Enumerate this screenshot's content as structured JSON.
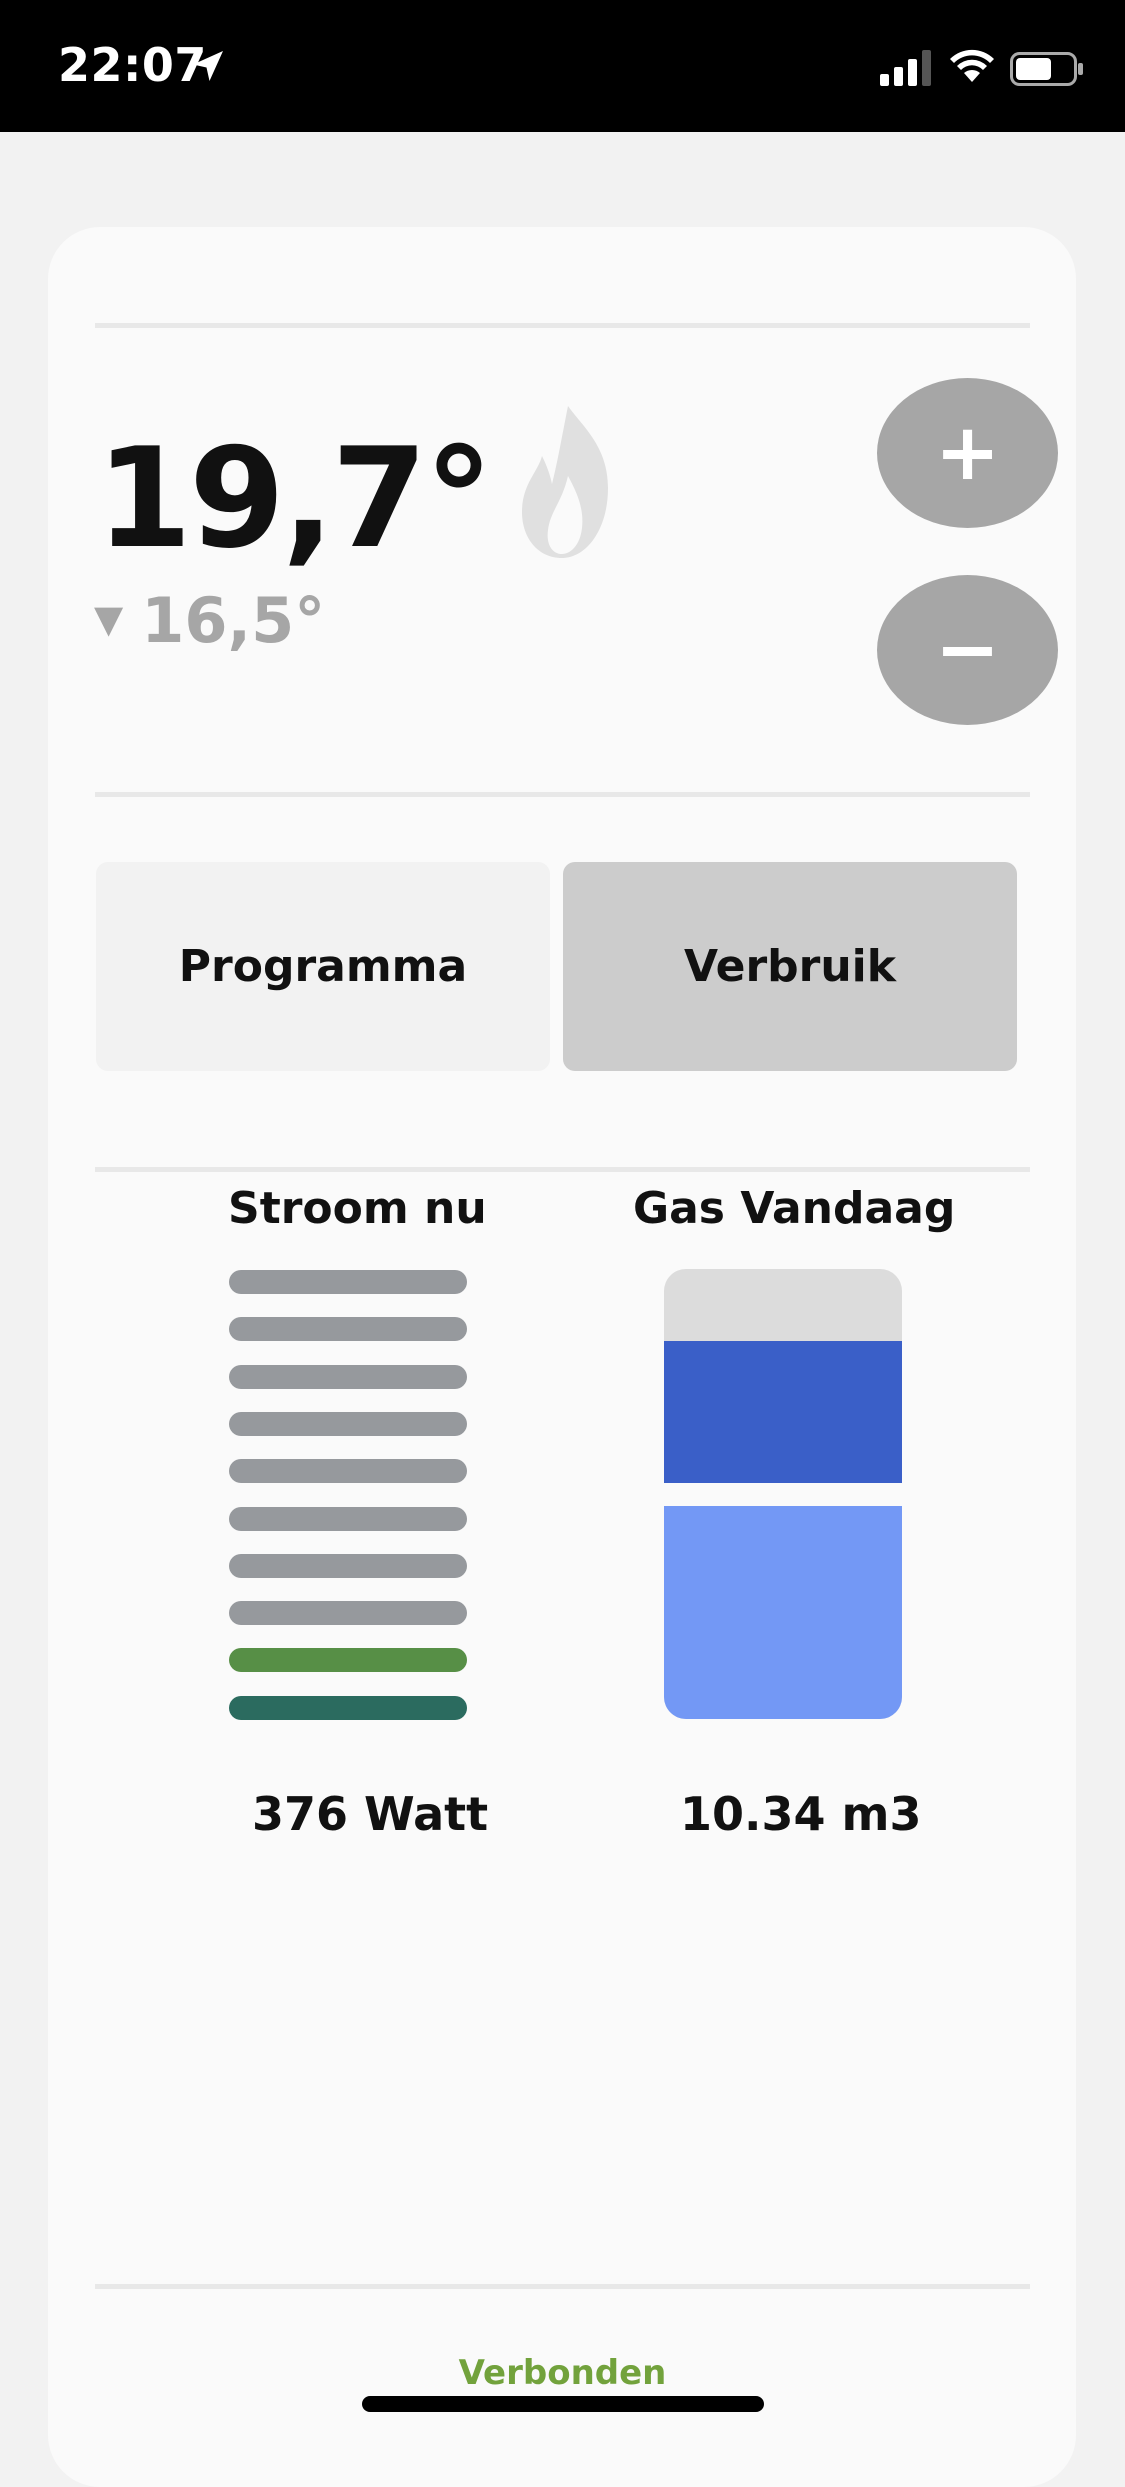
{
  "status_bar": {
    "time": "22:07",
    "icons": [
      "location-arrow-icon",
      "signal-icon",
      "wifi-icon",
      "battery-icon"
    ]
  },
  "thermostat": {
    "current_temp": "19,7°",
    "setpoint": "16,5°",
    "setpoint_icon": "down-triangle-icon",
    "heating_icon": "flame-icon",
    "increase_label": "+",
    "decrease_label": "−"
  },
  "tabs": [
    {
      "label": "Programma",
      "active": false
    },
    {
      "label": "Verbruik",
      "active": true
    }
  ],
  "usage": {
    "power": {
      "title": "Stroom nu",
      "value": "376 Watt",
      "bars_total": 10,
      "bars_lit": 2,
      "bar_colors": [
        "#96999d",
        "#96999d",
        "#96999d",
        "#96999d",
        "#96999d",
        "#96999d",
        "#96999d",
        "#96999d",
        "#578f46",
        "#2b6b5f"
      ]
    },
    "gas": {
      "title": "Gas Vandaag",
      "value": "10.34 m3",
      "colors": {
        "empty": "#dcdcdc",
        "dark": "#3a5fc8",
        "light": "#7398f5"
      }
    }
  },
  "footer": {
    "status": "Verbonden",
    "status_color": "#72a23c"
  }
}
